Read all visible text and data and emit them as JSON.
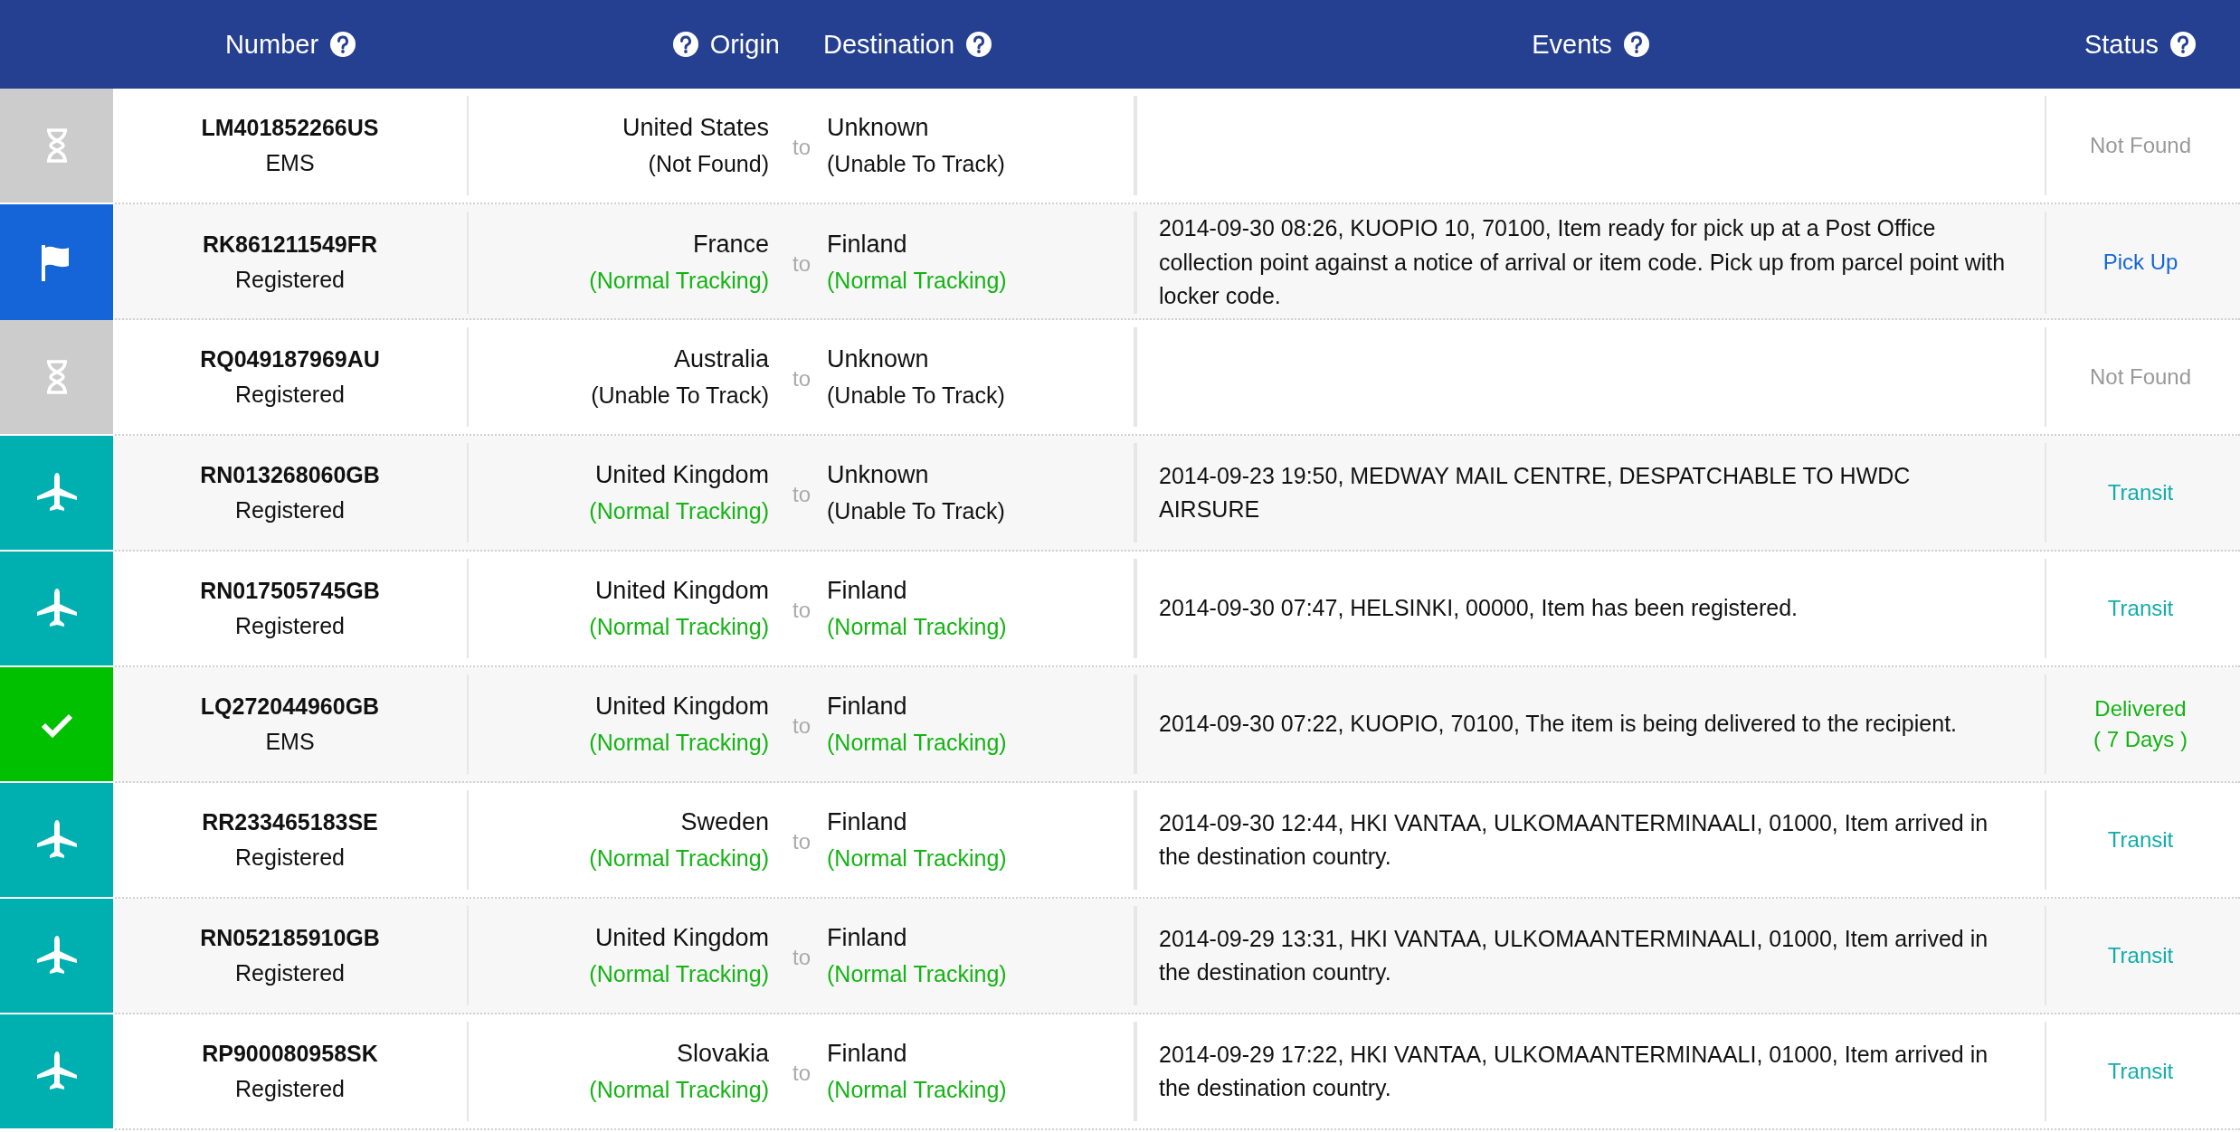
{
  "header": {
    "columns": [
      {
        "kind": "number",
        "label": "Number"
      },
      {
        "kind": "origin",
        "label": "Origin"
      },
      {
        "kind": "destination",
        "label": "Destination"
      },
      {
        "kind": "events",
        "label": "Events"
      },
      {
        "kind": "status",
        "label": "Status"
      }
    ]
  },
  "rows": [
    {
      "kind": "not_found",
      "number": "LM401852266US",
      "carrier": "EMS",
      "origin": {
        "country": "United States",
        "note": "(Not Found)",
        "kind": "not_found"
      },
      "connector": "to",
      "destination": {
        "country": "Unknown",
        "note": "(Unable To Track)",
        "kind": "unable"
      },
      "status": [
        "Not Found"
      ]
    },
    {
      "kind": "pickup",
      "number": "RK861211549FR",
      "carrier": "Registered",
      "origin": {
        "country": "France",
        "note": "(Normal Tracking)",
        "kind": "normal"
      },
      "connector": "to",
      "destination": {
        "country": "Finland",
        "note": "(Normal Tracking)",
        "kind": "normal"
      },
      "event": "2014-09-30 08:26, KUOPIO 10, 70100, Item ready for pick up at a Post Office collection point against a notice of arrival or item code. Pick up from parcel point with locker code.",
      "status": [
        "Pick Up"
      ]
    },
    {
      "kind": "not_found",
      "number": "RQ049187969AU",
      "carrier": "Registered",
      "origin": {
        "country": "Australia",
        "note": "(Unable To Track)",
        "kind": "unable"
      },
      "connector": "to",
      "destination": {
        "country": "Unknown",
        "note": "(Unable To Track)",
        "kind": "unable"
      },
      "status": [
        "Not Found"
      ]
    },
    {
      "kind": "transit",
      "number": "RN013268060GB",
      "carrier": "Registered",
      "origin": {
        "country": "United Kingdom",
        "note": "(Normal Tracking)",
        "kind": "normal"
      },
      "connector": "to",
      "destination": {
        "country": "Unknown",
        "note": "(Unable To Track)",
        "kind": "unable"
      },
      "event": "2014-09-23 19:50, MEDWAY MAIL CENTRE, DESPATCHABLE TO HWDC AIRSURE",
      "status": [
        "Transit"
      ]
    },
    {
      "kind": "transit",
      "number": "RN017505745GB",
      "carrier": "Registered",
      "origin": {
        "country": "United Kingdom",
        "note": "(Normal Tracking)",
        "kind": "normal"
      },
      "connector": "to",
      "destination": {
        "country": "Finland",
        "note": "(Normal Tracking)",
        "kind": "normal"
      },
      "event": "2014-09-30 07:47, HELSINKI, 00000, Item has been registered.",
      "status": [
        "Transit"
      ]
    },
    {
      "kind": "delivered",
      "number": "LQ272044960GB",
      "carrier": "EMS",
      "origin": {
        "country": "United Kingdom",
        "note": "(Normal Tracking)",
        "kind": "normal"
      },
      "connector": "to",
      "destination": {
        "country": "Finland",
        "note": "(Normal Tracking)",
        "kind": "normal"
      },
      "event": "2014-09-30 07:22, KUOPIO, 70100, The item is being delivered to the recipient.",
      "status": [
        "Delivered",
        "( 7 Days )"
      ]
    },
    {
      "kind": "transit",
      "number": "RR233465183SE",
      "carrier": "Registered",
      "origin": {
        "country": "Sweden",
        "note": "(Normal Tracking)",
        "kind": "normal"
      },
      "connector": "to",
      "destination": {
        "country": "Finland",
        "note": "(Normal Tracking)",
        "kind": "normal"
      },
      "event": "2014-09-30 12:44, HKI VANTAA, ULKOMAANTERMINAALI, 01000, Item arrived in the destination country.",
      "status": [
        "Transit"
      ]
    },
    {
      "kind": "transit",
      "number": "RN052185910GB",
      "carrier": "Registered",
      "origin": {
        "country": "United Kingdom",
        "note": "(Normal Tracking)",
        "kind": "normal"
      },
      "connector": "to",
      "destination": {
        "country": "Finland",
        "note": "(Normal Tracking)",
        "kind": "normal"
      },
      "event": "2014-09-29 13:31, HKI VANTAA, ULKOMAANTERMINAALI, 01000, Item arrived in the destination country.",
      "status": [
        "Transit"
      ]
    },
    {
      "kind": "transit",
      "number": "RP900080958SK",
      "carrier": "Registered",
      "origin": {
        "country": "Slovakia",
        "note": "(Normal Tracking)",
        "kind": "normal"
      },
      "connector": "to",
      "destination": {
        "country": "Finland",
        "note": "(Normal Tracking)",
        "kind": "normal"
      },
      "event": "2014-09-29 17:22, HKI VANTAA, ULKOMAANTERMINAALI, 01000, Item arrived in the destination country.",
      "status": [
        "Transit"
      ]
    }
  ]
}
